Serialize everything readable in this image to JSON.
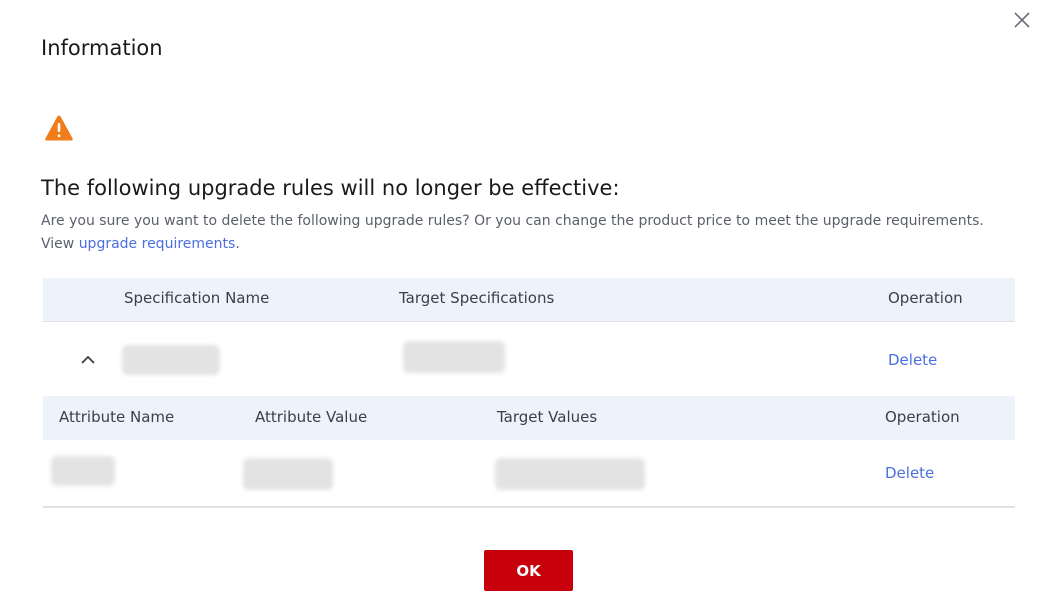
{
  "dialog": {
    "title": "Information",
    "close_icon": "close-icon",
    "warning_icon": "warning-icon",
    "headline": "The following upgrade rules will no longer be effective:",
    "description_text": "Are you sure you want to delete the following upgrade rules? Or you can change the product price to meet the upgrade requirements. View ",
    "description_link": "upgrade requirements",
    "description_end": ".",
    "ok_label": "OK"
  },
  "spec_table": {
    "headers": {
      "spec_name": "Specification Name",
      "target_specs": "Target Specifications",
      "operation": "Operation"
    },
    "rows": [
      {
        "delete_label": "Delete"
      }
    ]
  },
  "attr_table": {
    "headers": {
      "attr_name": "Attribute Name",
      "attr_value": "Attribute Value",
      "target_values": "Target Values",
      "operation": "Operation"
    },
    "rows": [
      {
        "delete_label": "Delete"
      }
    ]
  },
  "colors": {
    "accent_link": "#4a6fe0",
    "primary_button": "#c7000b",
    "warning": "#f07d1a",
    "header_bg": "#eef2fb"
  }
}
